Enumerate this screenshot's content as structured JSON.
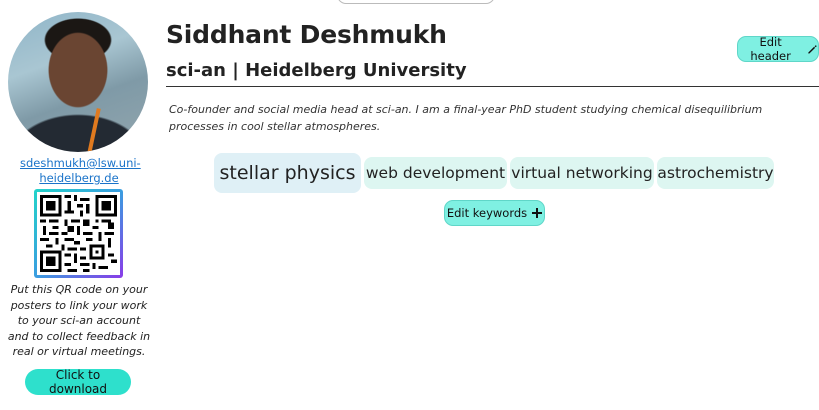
{
  "profile": {
    "name": "Siddhant Deshmukh",
    "affiliation": "sci-an | Heidelberg University",
    "email": "sdeshmukh@lsw.uni-heidelberg.de",
    "bio": "Co-founder and social media head at sci-an. I am a final-year PhD student studying chemical disequilibrium processes in cool stellar atmospheres."
  },
  "actions": {
    "edit_header_label": "Edit header",
    "edit_keywords_label": "Edit keywords",
    "download_label": "Click to download"
  },
  "qr": {
    "note": "Put this QR code on your posters to link your work to your sci-an account and to collect feedback in real or virtual meetings."
  },
  "keywords": [
    {
      "label": "stellar physics"
    },
    {
      "label": "web development"
    },
    {
      "label": "virtual networking"
    },
    {
      "label": "astrochemistry"
    }
  ],
  "colors": {
    "accent": "#2ee0cc",
    "accent_light": "#7ff0e2",
    "link": "#1a73c9",
    "keyword_primary_bg": "#dff0f6",
    "keyword_bg": "#ddf6f1"
  },
  "icons": {
    "edit_header": "pencil-icon",
    "edit_keywords": "plus-icon"
  }
}
